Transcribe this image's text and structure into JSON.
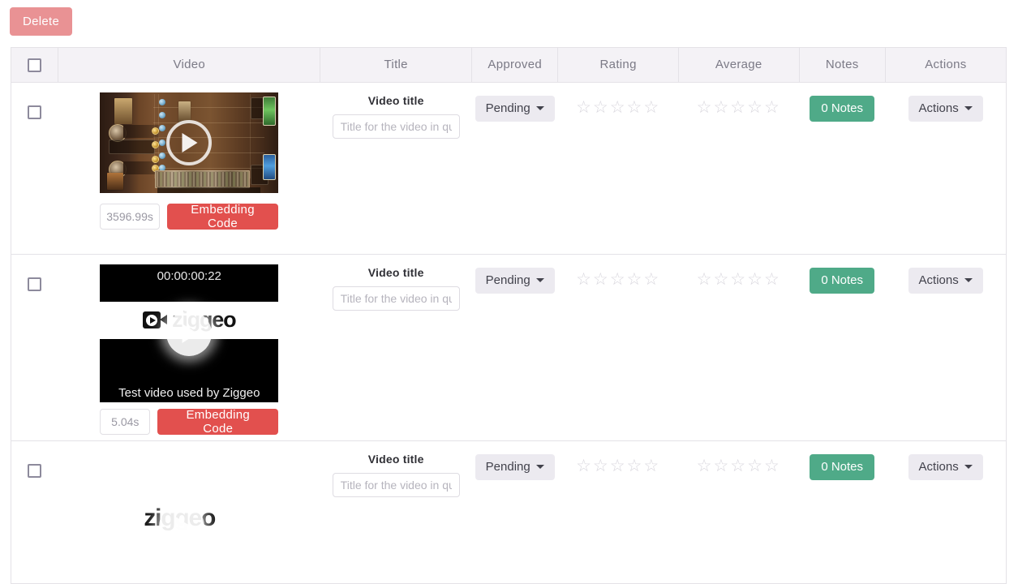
{
  "toolbar": {
    "delete_label": "Delete"
  },
  "table": {
    "headers": [
      "",
      "Video",
      "Title",
      "Approved",
      "Rating",
      "Average",
      "Notes",
      "Actions"
    ],
    "select_all_icon": "checkbox-unchecked"
  },
  "common": {
    "title_label": "Video title",
    "title_placeholder": "Title for the video in question",
    "title_value": "",
    "approved_label": "Pending",
    "notes_label": "0 Notes",
    "actions_label": "Actions",
    "embed_label": "Embedding Code",
    "star_glyph": "☆",
    "rating_stars": 5,
    "average_stars": 5,
    "rating_filled": 0,
    "average_filled": 0
  },
  "rows": [
    {
      "id": "row-1",
      "checked": false,
      "duration": "3596.99s",
      "thumbnail_kind": "game-board",
      "thumbnail_alt": "Card game board video frame"
    },
    {
      "id": "row-2",
      "checked": false,
      "duration": "5.04s",
      "thumbnail_kind": "ziggeo-test",
      "timecode": "00:00:00:22",
      "caption": "Test video used by Ziggeo",
      "wordmark": "ziggeo"
    },
    {
      "id": "row-3",
      "checked": false,
      "duration": "",
      "thumbnail_kind": "ziggeo-plain",
      "wordmark": "ziggeo"
    }
  ],
  "colors": {
    "delete_button": "#e99294",
    "embed_button": "#e2504e",
    "notes_button": "#4faa88",
    "header_bg": "#f4f2f6",
    "border": "#e4e2e7",
    "soft_button": "#eceaf0"
  }
}
